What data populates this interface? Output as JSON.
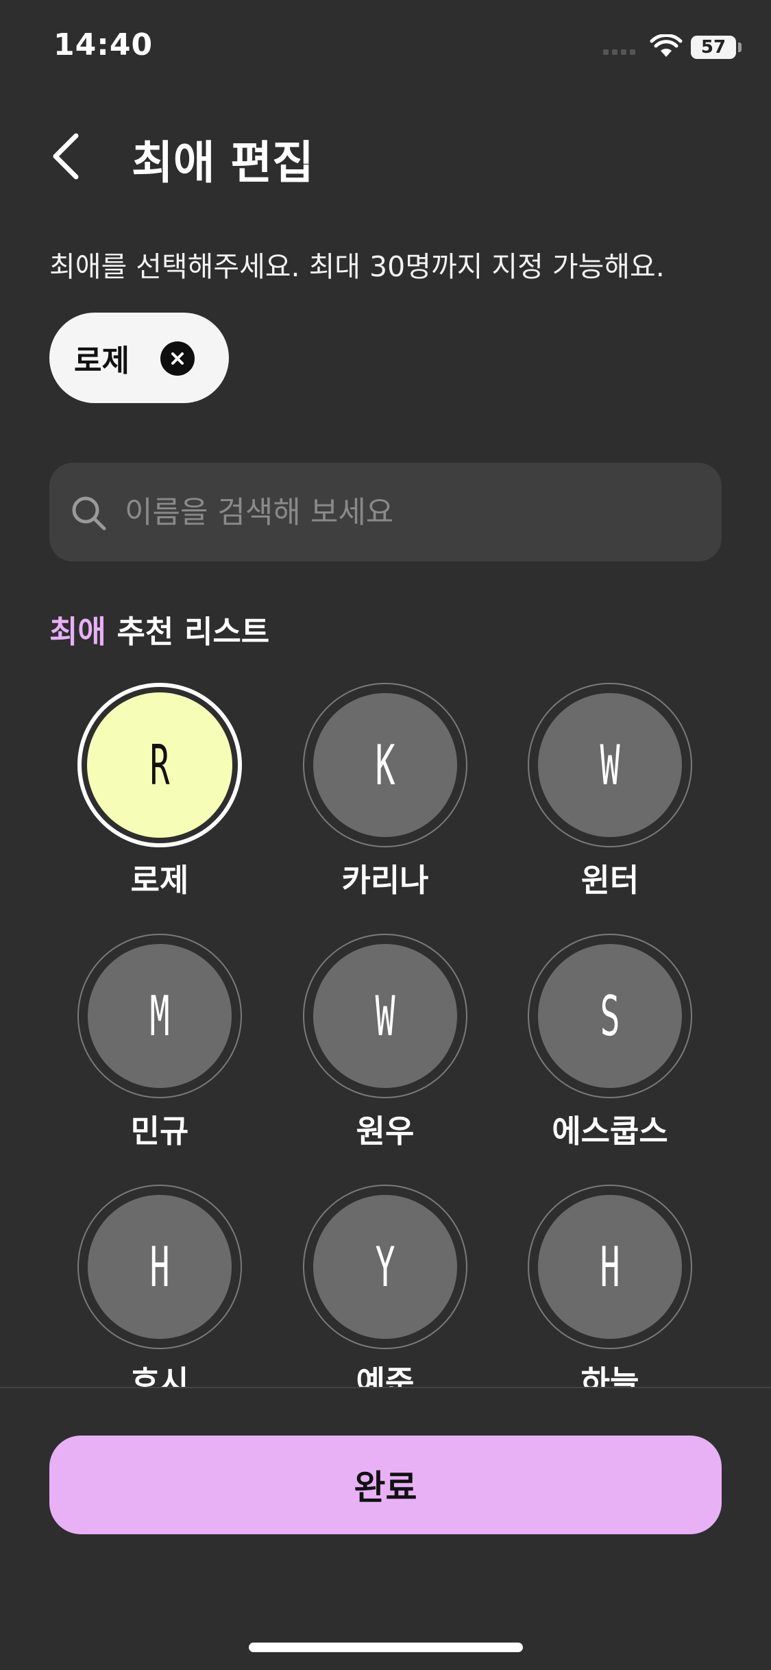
{
  "status_bar": {
    "time": "14:40",
    "battery": "57"
  },
  "header": {
    "title": "최애 편집"
  },
  "instruction": "최애를 선택해주세요. 최대 30명까지 지정 가능해요.",
  "selected_chips": [
    {
      "label": "로제"
    }
  ],
  "search": {
    "placeholder": "이름을 검색해 보세요",
    "value": ""
  },
  "section": {
    "accent": "최애",
    "title": " 추천 리스트"
  },
  "recommendations": [
    {
      "name": "로제",
      "initial": "R",
      "selected": true
    },
    {
      "name": "카리나",
      "initial": "K",
      "selected": false
    },
    {
      "name": "윈터",
      "initial": "W",
      "selected": false
    },
    {
      "name": "민규",
      "initial": "M",
      "selected": false
    },
    {
      "name": "원우",
      "initial": "W",
      "selected": false
    },
    {
      "name": "에스쿱스",
      "initial": "S",
      "selected": false
    },
    {
      "name": "호시",
      "initial": "H",
      "selected": false
    },
    {
      "name": "예준",
      "initial": "Y",
      "selected": false
    },
    {
      "name": "하늘",
      "initial": "H",
      "selected": false
    }
  ],
  "footer": {
    "complete_label": "완료"
  },
  "colors": {
    "background": "#2e2e2e",
    "accent": "#e8b1f6",
    "selected_avatar": "#f6fdb6",
    "avatar": "#6b6b6b",
    "search_bg": "#3f3f3f"
  }
}
